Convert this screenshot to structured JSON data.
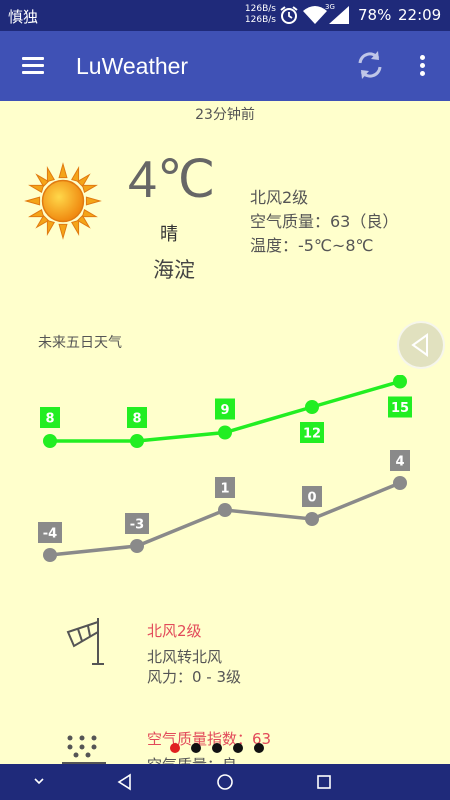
{
  "status_bar": {
    "carrier": "慎独",
    "net_up": "126B/s",
    "net_down": "126B/s",
    "network_type": "3G",
    "battery": "78%",
    "time": "22:09",
    "icons": [
      "alarm-icon",
      "wifi-icon",
      "signal-icon",
      "battery-icon"
    ]
  },
  "app_bar": {
    "title": "LuWeather",
    "icons": [
      "menu-icon",
      "refresh-icon",
      "more-vert-icon"
    ]
  },
  "current": {
    "updated": "23分钟前",
    "temperature": "4℃",
    "condition": "晴",
    "city": "海淀",
    "condition_icon": "sunny-icon",
    "wind": "北风2级",
    "air_quality": "空气质量：63（良）",
    "temp_range": "温度：-5℃~8℃"
  },
  "forecast": {
    "label": "未来五日天气",
    "colors": {
      "high": "#22EE22",
      "low": "#8A8A8A"
    }
  },
  "chart_data": {
    "type": "line",
    "title": "未来五日天气",
    "x": [
      1,
      2,
      3,
      4,
      5
    ],
    "series": [
      {
        "values": [
          8,
          8,
          9,
          12,
          15
        ]
      },
      {
        "values": [
          -4,
          -3,
          1,
          0,
          4
        ]
      }
    ]
  },
  "wind_section": {
    "title": "北风2级",
    "direction": "北风转北风",
    "force": "风力：0 - 3级",
    "icon": "windsock-icon"
  },
  "aqi_section": {
    "title": "空气质量指数：63",
    "sub": "空气质量：良",
    "icon": "air-quality-icon"
  },
  "pager": {
    "count": 5,
    "active": 0,
    "colors": {
      "active": "#E02020",
      "inactive": "#111111"
    }
  },
  "nav_bar": {
    "icons": [
      "collapse-icon",
      "back-icon",
      "home-icon",
      "recents-icon"
    ]
  }
}
